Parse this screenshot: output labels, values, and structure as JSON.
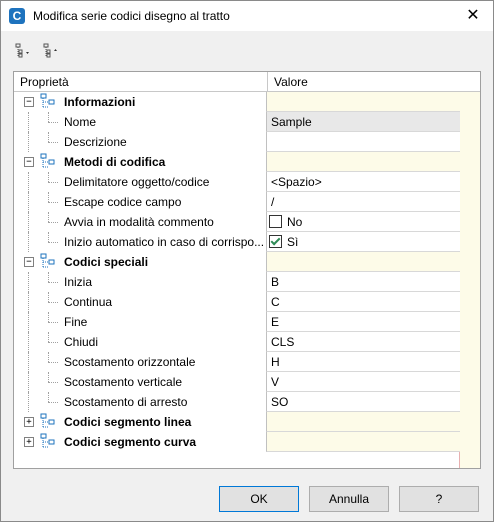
{
  "window": {
    "title": "Modifica serie codici disegno al tratto"
  },
  "toolbar": {
    "sort_icon": "sort-categorized-icon",
    "sort_alpha_icon": "sort-alphabetic-icon"
  },
  "grid": {
    "header": {
      "col1": "Proprietà",
      "col2": "Valore"
    },
    "rows": [
      {
        "type": "cat",
        "label": "Informazioni",
        "expanded": true
      },
      {
        "type": "item",
        "label": "Nome",
        "value": "Sample",
        "style": "gray"
      },
      {
        "type": "item",
        "label": "Descrizione",
        "value": ""
      },
      {
        "type": "cat",
        "label": "Metodi di codifica",
        "expanded": true
      },
      {
        "type": "item",
        "label": "Delimitatore oggetto/codice",
        "value": "<Spazio>"
      },
      {
        "type": "item",
        "label": "Escape codice campo",
        "value": "/"
      },
      {
        "type": "item",
        "label": "Avvia in modalità commento",
        "check": false,
        "value": "No"
      },
      {
        "type": "item",
        "label": "Inizio automatico in caso di corrispo...",
        "check": true,
        "value": "Sì"
      },
      {
        "type": "cat",
        "label": "Codici speciali",
        "expanded": true
      },
      {
        "type": "item",
        "label": "Inizia",
        "value": "B"
      },
      {
        "type": "item",
        "label": "Continua",
        "value": "C"
      },
      {
        "type": "item",
        "label": "Fine",
        "value": "E"
      },
      {
        "type": "item",
        "label": "Chiudi",
        "value": "CLS"
      },
      {
        "type": "item",
        "label": "Scostamento orizzontale",
        "value": "H"
      },
      {
        "type": "item",
        "label": "Scostamento verticale",
        "value": "V"
      },
      {
        "type": "item",
        "label": "Scostamento di arresto",
        "value": "SO"
      },
      {
        "type": "cat",
        "label": "Codici segmento linea",
        "expanded": false
      },
      {
        "type": "cat",
        "label": "Codici segmento curva",
        "expanded": false
      }
    ]
  },
  "buttons": {
    "ok": "OK",
    "cancel": "Annulla",
    "help": "?"
  },
  "colors": {
    "accent": "#0078d7",
    "category_bg": "#fdfbe8",
    "icon_blue": "#1e73be"
  }
}
